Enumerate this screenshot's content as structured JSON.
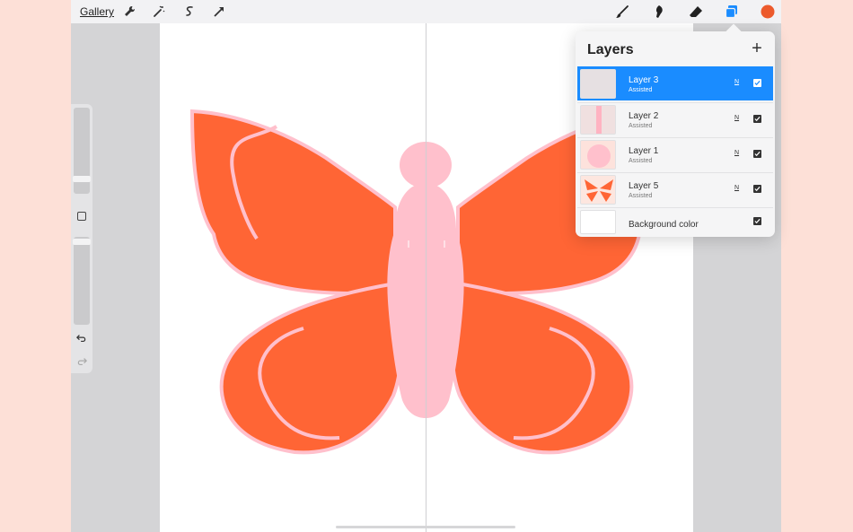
{
  "topbar": {
    "gallery_label": "Gallery",
    "left_tools": [
      "wrench-icon",
      "magic-wand-icon",
      "selection-icon",
      "transform-arrow-icon"
    ],
    "right_tools": [
      "brush-icon",
      "smudge-icon",
      "eraser-icon",
      "layers-icon"
    ],
    "current_color": "#ec5a2c"
  },
  "sidebar": {
    "brush_size": 0.15,
    "opacity": 0.03,
    "modify_button": "square-icon",
    "undo_icon": "undo-icon",
    "redo_icon": "redo-icon"
  },
  "canvas": {
    "artwork": "butterfly",
    "wing_color": "#ff6535",
    "outline_color": "#ffc0cc",
    "body_color": "#ffc0cc",
    "drawing_assist": "symmetry-vertical"
  },
  "layers_panel": {
    "title": "Layers",
    "add_icon": "+",
    "layers": [
      {
        "name": "Layer 3",
        "sub": "Assisted",
        "blend": "N",
        "visible": true,
        "active": true
      },
      {
        "name": "Layer 2",
        "sub": "Assisted",
        "blend": "N",
        "visible": true,
        "active": false
      },
      {
        "name": "Layer 1",
        "sub": "Assisted",
        "blend": "N",
        "visible": true,
        "active": false
      },
      {
        "name": "Layer 5",
        "sub": "Assisted",
        "blend": "N",
        "visible": true,
        "active": false
      }
    ],
    "background": {
      "name": "Background color",
      "visible": true,
      "color": "#ffffff"
    }
  }
}
